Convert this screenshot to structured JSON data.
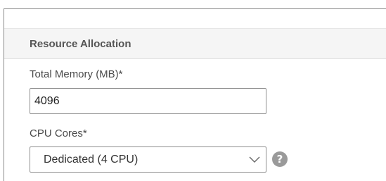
{
  "section": {
    "title": "Resource Allocation"
  },
  "memory": {
    "label": "Total Memory (MB)*",
    "value": "4096"
  },
  "cpu": {
    "label": "CPU Cores*",
    "selected": "Dedicated (4 CPU)"
  },
  "icons": {
    "dropdown": "chevron-down-icon",
    "help": "help-icon",
    "help_glyph": "?"
  },
  "colors": {
    "header_bg": "#f5f5f5",
    "help_icon_bg": "#9a9a9a",
    "border": "#8f8f8f"
  }
}
